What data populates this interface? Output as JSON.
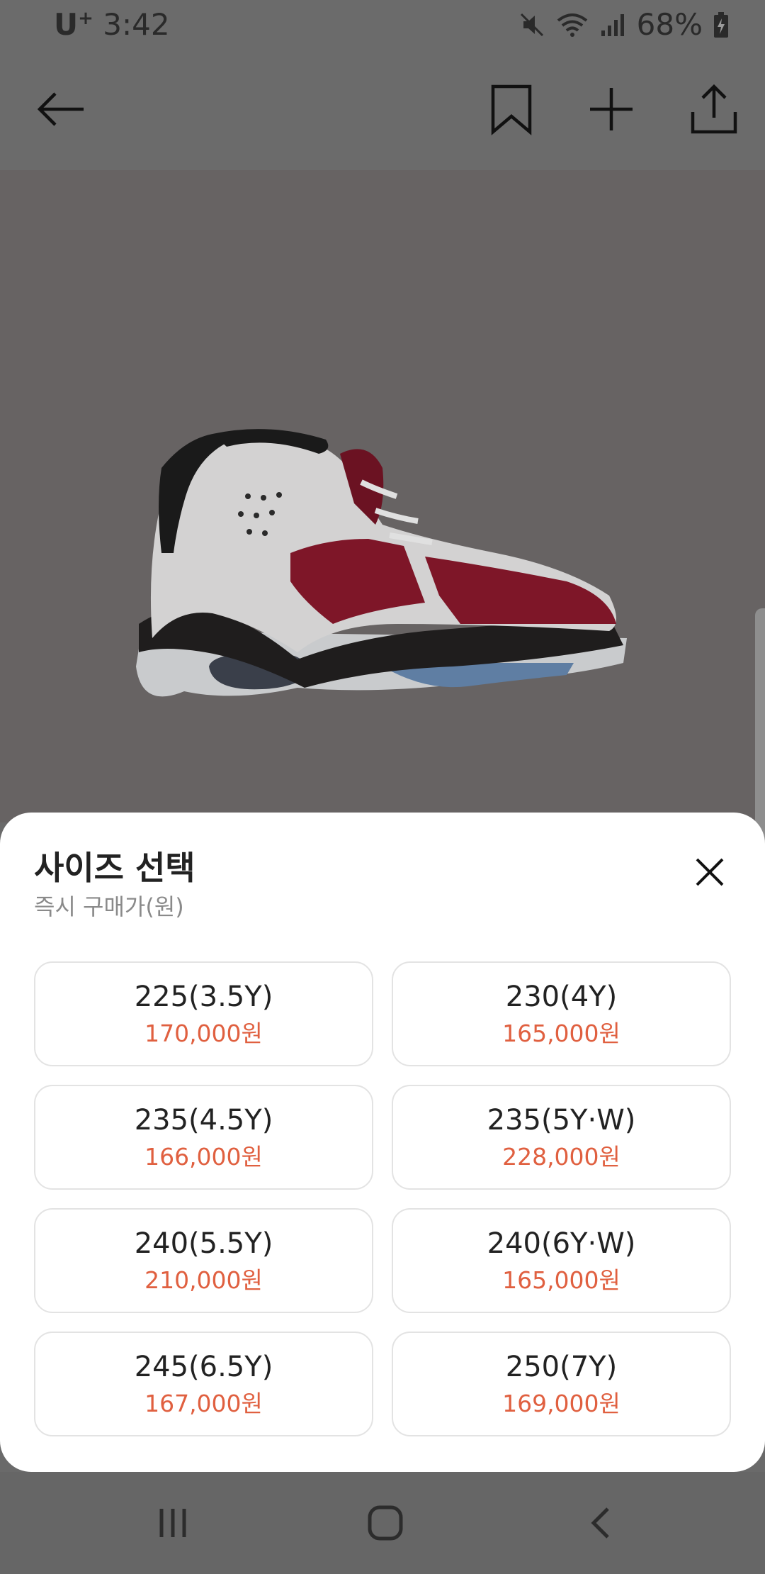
{
  "status_bar": {
    "carrier": "U",
    "carrier_mark": "+",
    "time": "3:42",
    "battery": "68%"
  },
  "icons": {
    "mute": "mute-icon",
    "wifi": "wifi-icon",
    "signal": "signal-icon",
    "battery": "battery-charging-icon",
    "back": "back-arrow-icon",
    "bookmark": "bookmark-icon",
    "add": "plus-icon",
    "share": "share-icon",
    "close": "close-icon",
    "nav_recents": "recents-icon",
    "nav_home": "home-icon",
    "nav_back": "nav-back-icon"
  },
  "product": {
    "image": "shoe-image"
  },
  "sheet": {
    "title": "사이즈 선택",
    "subtitle": "즉시 구매가(원)",
    "sizes": [
      {
        "label": "225(3.5Y)",
        "price": "170,000원"
      },
      {
        "label": "230(4Y)",
        "price": "165,000원"
      },
      {
        "label": "235(4.5Y)",
        "price": "166,000원"
      },
      {
        "label": "235(5Y·W)",
        "price": "228,000원"
      },
      {
        "label": "240(5.5Y)",
        "price": "210,000원"
      },
      {
        "label": "240(6Y·W)",
        "price": "165,000원"
      },
      {
        "label": "245(6.5Y)",
        "price": "167,000원"
      },
      {
        "label": "250(7Y)",
        "price": "169,000원"
      }
    ]
  },
  "colors": {
    "price": "#e06040",
    "overlay": "#6b6b6b"
  }
}
